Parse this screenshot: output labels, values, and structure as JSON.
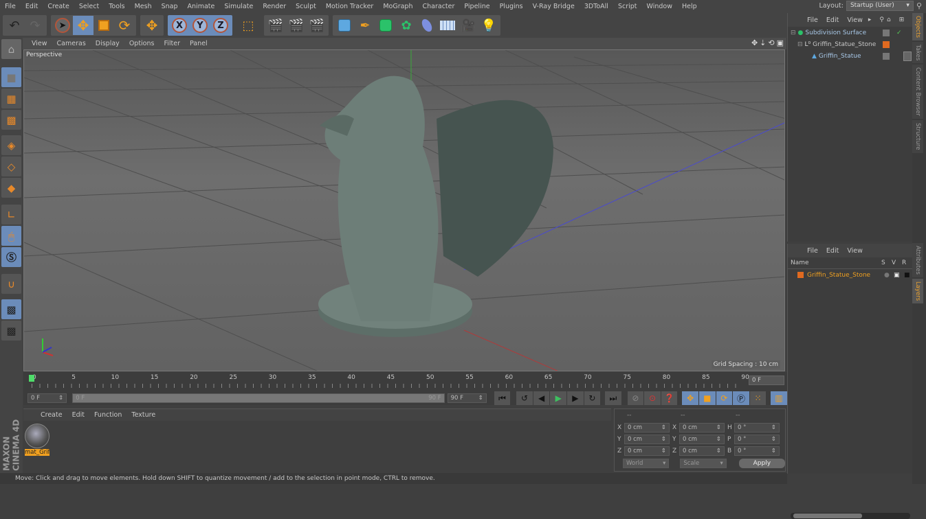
{
  "menubar": {
    "items": [
      "File",
      "Edit",
      "Create",
      "Select",
      "Tools",
      "Mesh",
      "Snap",
      "Animate",
      "Simulate",
      "Render",
      "Sculpt",
      "Motion Tracker",
      "MoGraph",
      "Character",
      "Pipeline",
      "Plugins",
      "V-Ray Bridge",
      "3DToAll",
      "Script",
      "Window",
      "Help"
    ],
    "layout_label": "Layout:",
    "layout_value": "Startup (User)"
  },
  "toolbar": {
    "undo": "undo-icon",
    "redo": "redo-icon",
    "axis_x": "X",
    "axis_y": "Y",
    "axis_z": "Z"
  },
  "viewport": {
    "menu": [
      "View",
      "Cameras",
      "Display",
      "Options",
      "Filter",
      "Panel"
    ],
    "camera_label": "Perspective",
    "grid_spacing": "Grid Spacing : 10 cm",
    "object": "Griffin statue"
  },
  "timeline": {
    "ticks": [
      "0",
      "5",
      "10",
      "15",
      "20",
      "25",
      "30",
      "35",
      "40",
      "45",
      "50",
      "55",
      "60",
      "65",
      "70",
      "75",
      "80",
      "85",
      "90"
    ],
    "current_frame": "0 F",
    "start_field": "0 F",
    "range_start": "0 F",
    "range_end": "90 F",
    "end_field": "90 F"
  },
  "material_manager": {
    "menu": [
      "Create",
      "Edit",
      "Function",
      "Texture"
    ],
    "materials": [
      {
        "name": "mat_Grif"
      }
    ]
  },
  "coordinates": {
    "headers": [
      "--",
      "--",
      "--"
    ],
    "rows": [
      {
        "a1": "X",
        "v1": "0 cm",
        "a2": "X",
        "v2": "0 cm",
        "a3": "H",
        "v3": "0 °"
      },
      {
        "a1": "Y",
        "v1": "0 cm",
        "a2": "Y",
        "v2": "0 cm",
        "a3": "P",
        "v3": "0 °"
      },
      {
        "a1": "Z",
        "v1": "0 cm",
        "a2": "Z",
        "v2": "0 cm",
        "a3": "B",
        "v3": "0 °"
      }
    ],
    "mode": "World",
    "type": "Scale",
    "apply": "Apply"
  },
  "brand": "MAXON CINEMA 4D",
  "status": "Move: Click and drag to move elements. Hold down SHIFT to quantize movement / add to the selection in point mode, CTRL to remove.",
  "object_manager": {
    "menu": [
      "File",
      "Edit",
      "View"
    ],
    "objects": [
      {
        "name": "Subdivision Surface",
        "indent": 0
      },
      {
        "name": "Griffin_Statue_Stone",
        "indent": 1
      },
      {
        "name": "Griffin_Statue",
        "indent": 2
      }
    ]
  },
  "layer_manager": {
    "menu": [
      "File",
      "Edit",
      "View"
    ],
    "columns": [
      "Name",
      "S",
      "V",
      "R"
    ],
    "layers": [
      {
        "name": "Griffin_Statue_Stone",
        "color": "#e06a20"
      }
    ]
  },
  "side_tabs": {
    "top": [
      "Objects",
      "Takes",
      "Content Browser",
      "Structure"
    ],
    "bottom": [
      "Attributes",
      "Layers"
    ]
  },
  "colors": {
    "accent": "#6b8cba",
    "highlight": "#f0a020",
    "layer": "#e06a20"
  }
}
